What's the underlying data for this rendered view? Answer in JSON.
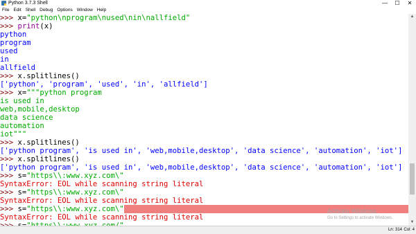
{
  "window": {
    "title": "Python 3.7.3 Shell",
    "minimize": "—",
    "maximize": "☐",
    "close": "✕"
  },
  "menu": [
    "File",
    "Edit",
    "Shell",
    "Debug",
    "Options",
    "Window",
    "Help"
  ],
  "lines": [
    [
      {
        "t": ">>> ",
        "c": "p"
      },
      {
        "t": "x=",
        "c": "b"
      },
      {
        "t": "\"python\\nprogram\\nused\\nin\\nallfield\"",
        "c": "s"
      }
    ],
    [
      {
        "t": ">>> ",
        "c": "p"
      },
      {
        "t": "print",
        "c": "k"
      },
      {
        "t": "(x)",
        "c": "b"
      }
    ],
    [
      {
        "t": "python",
        "c": "o"
      }
    ],
    [
      {
        "t": "program",
        "c": "o"
      }
    ],
    [
      {
        "t": "used",
        "c": "o"
      }
    ],
    [
      {
        "t": "in",
        "c": "o"
      }
    ],
    [
      {
        "t": "allfield",
        "c": "o"
      }
    ],
    [
      {
        "t": ">>> ",
        "c": "p"
      },
      {
        "t": "x.splitlines()",
        "c": "b"
      }
    ],
    [
      {
        "t": "['python', 'program', 'used', 'in', 'allfield']",
        "c": "o"
      }
    ],
    [
      {
        "t": ">>> ",
        "c": "p"
      },
      {
        "t": "x=",
        "c": "b"
      },
      {
        "t": "\"\"\"python program",
        "c": "s"
      }
    ],
    [
      {
        "t": "is used in",
        "c": "s"
      }
    ],
    [
      {
        "t": "web,mobile,desktop",
        "c": "s"
      }
    ],
    [
      {
        "t": "data science",
        "c": "s"
      }
    ],
    [
      {
        "t": "automation",
        "c": "s"
      }
    ],
    [
      {
        "t": "iot\"\"\"",
        "c": "s"
      }
    ],
    [
      {
        "t": ">>> ",
        "c": "p"
      },
      {
        "t": "x.splitlines()",
        "c": "b"
      }
    ],
    [
      {
        "t": "['python program', 'is used in', 'web,mobile,desktop', 'data science', 'automation', 'iot']",
        "c": "o"
      }
    ],
    [
      {
        "t": ">>> ",
        "c": "p"
      },
      {
        "t": "x.splitlines()",
        "c": "b"
      }
    ],
    [
      {
        "t": "['python program', 'is used in', 'web,mobile,desktop', 'data science', 'automation', 'iot']",
        "c": "o"
      }
    ],
    [
      {
        "t": ">>> ",
        "c": "p"
      },
      {
        "t": "s=",
        "c": "b"
      },
      {
        "t": "\"https\\\\:www.xyz.com\\\"",
        "c": "s"
      }
    ],
    [
      {
        "t": "SyntaxError: EOL while scanning string literal",
        "c": "e"
      }
    ],
    [
      {
        "t": ">>> ",
        "c": "p"
      },
      {
        "t": "s=",
        "c": "b"
      },
      {
        "t": "\"https\\\\:www.xyz.com\\\"",
        "c": "s"
      }
    ],
    [
      {
        "t": "SyntaxError: EOL while scanning string literal",
        "c": "e"
      }
    ],
    [
      {
        "t": ">>> ",
        "c": "p"
      },
      {
        "t": "s=",
        "c": "b"
      },
      {
        "t": "\"https\\\\:www.xyz.com\\\"",
        "c": "s"
      },
      {
        "t": "",
        "c": "hl",
        "fill": true
      }
    ],
    [
      {
        "t": "SyntaxError: EOL while scanning string literal",
        "c": "e"
      }
    ],
    [
      {
        "t": ">>> ",
        "c": "p"
      },
      {
        "t": "s=",
        "c": "b"
      },
      {
        "t": "\"https\\\\:www.xyz.com/\"",
        "c": "s"
      }
    ]
  ],
  "scrollbar": {
    "up": "▲",
    "down": "▼",
    "position": 0.85
  },
  "watermark": {
    "line1": "Activate Windows",
    "line2": "Go to Settings to activate Windows."
  },
  "status": {
    "line": "Ln: 314",
    "col": "Col: 4"
  },
  "colors": {
    "prompt": "#800000",
    "string": "#00aa00",
    "output": "#0000ff",
    "error": "#dd0000",
    "keyword": "#900090",
    "error_highlight": "#f08080"
  }
}
